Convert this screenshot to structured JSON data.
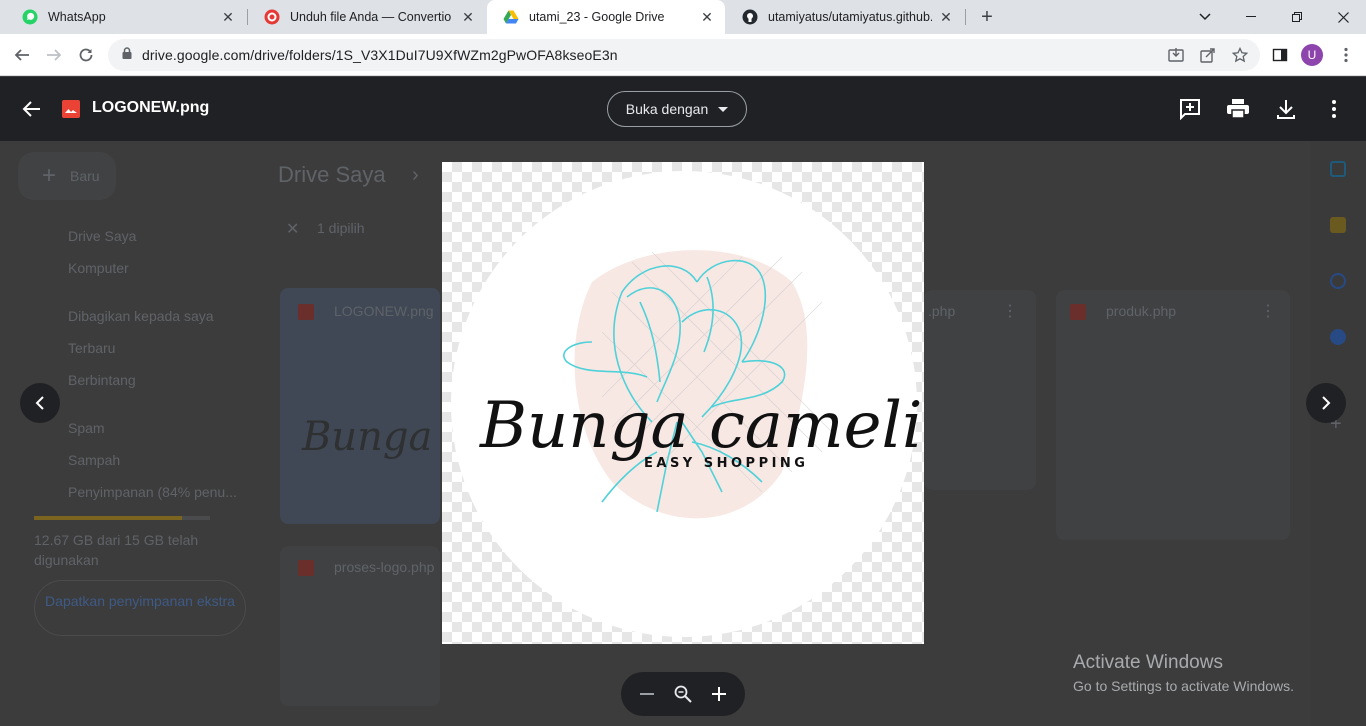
{
  "browser": {
    "tabs": [
      {
        "title": "WhatsApp",
        "icon": "whatsapp-icon"
      },
      {
        "title": "Unduh file Anda — Convertio",
        "icon": "convertio-icon"
      },
      {
        "title": "utami_23 - Google Drive",
        "icon": "google-drive-icon"
      },
      {
        "title": "utamiyatus/utamiyatus.github.io",
        "icon": "github-icon"
      }
    ],
    "url": "drive.google.com/drive/folders/1S_V3X1DuI7U9XfWZm2gPwOFA8kseoE3n",
    "profile_initial": "U"
  },
  "viewer": {
    "file_name": "LOGONEW.png",
    "open_with_label": "Buka dengan"
  },
  "logo": {
    "brand": "Bunga camelia",
    "tagline": "EASY SHOPPING",
    "colors": {
      "script": "#111111",
      "flower": "#4fd1d9",
      "wash": "#f7e4df"
    }
  },
  "drive_background": {
    "new_label": "Baru",
    "breadcrumb": "Drive Saya",
    "selection": "1 dipilih",
    "nav": [
      "Drive Saya",
      "Komputer",
      "Dibagikan kepada saya",
      "Terbaru",
      "Berbintang",
      "Spam",
      "Sampah",
      "Penyimpanan (84% penu..."
    ],
    "storage_text": "12.67 GB dari 15 GB telah digunakan",
    "storage_fraction": 0.84,
    "get_storage_label": "Dapatkan penyimpanan ekstra",
    "files": [
      "LOGONEW.png",
      ".php",
      "produk.php",
      "proses-logo.php"
    ]
  },
  "watermark": {
    "title": "Activate Windows",
    "subtitle": "Go to Settings to activate Windows."
  }
}
